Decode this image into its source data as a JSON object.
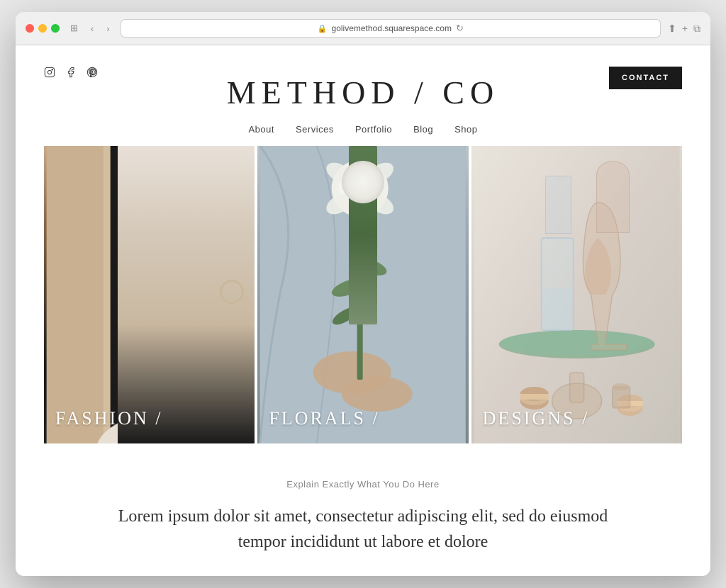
{
  "browser": {
    "url": "golivemethod.squarespace.com",
    "controls": {
      "back": "‹",
      "forward": "›"
    },
    "actions": [
      "share",
      "new-tab",
      "windows"
    ]
  },
  "site": {
    "title": "METHOD / CO",
    "contact_button": "CONTACT",
    "social_icons": [
      "instagram",
      "facebook",
      "pinterest"
    ],
    "nav": {
      "items": [
        "About",
        "Services",
        "Portfolio",
        "Blog",
        "Shop"
      ]
    },
    "grid": {
      "items": [
        {
          "label": "FASHION /",
          "theme": "fashion"
        },
        {
          "label": "FLORALS /",
          "theme": "florals"
        },
        {
          "label": "DESIGNS /",
          "theme": "designs"
        }
      ]
    },
    "body": {
      "tagline": "Explain Exactly What You Do Here",
      "text": "Lorem ipsum dolor sit amet, consectetur adipiscing elit, sed do eiusmod tempor incididunt ut labore et dolore"
    }
  }
}
